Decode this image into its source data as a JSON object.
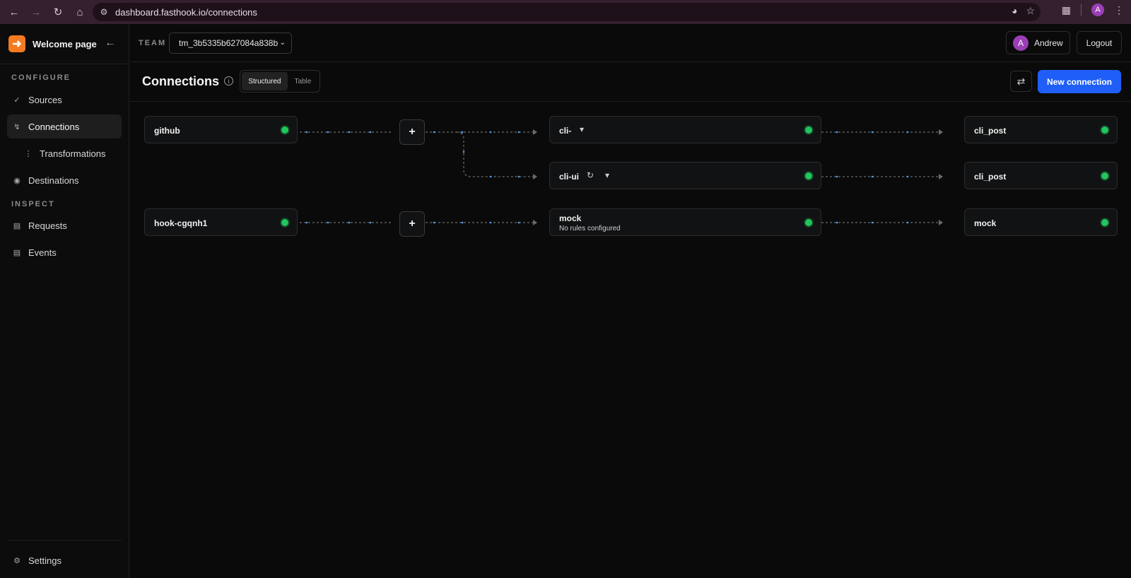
{
  "browser": {
    "url": "dashboard.fasthook.io/connections",
    "profile_initial": "A"
  },
  "sidebar": {
    "brand": "Welcome page",
    "sections": {
      "configure": "CONFIGURE",
      "inspect": "INSPECT"
    },
    "items": {
      "sources": "Sources",
      "connections": "Connections",
      "transformations": "Transformations",
      "destinations": "Destinations",
      "requests": "Requests",
      "events": "Events",
      "settings": "Settings"
    }
  },
  "topbar": {
    "team_label": "TEAM",
    "team_value": "tm_3b5335b627084a838b",
    "user_initial": "A",
    "user_name": "Andrew",
    "logout": "Logout"
  },
  "page": {
    "title": "Connections",
    "view_options": [
      "Structured",
      "Table"
    ],
    "active_view": "Structured",
    "new_connection": "New connection"
  },
  "graph": {
    "sources": [
      "github",
      "hook-cgqnh1"
    ],
    "connections": [
      {
        "name": "cli-",
        "subtitle": ""
      },
      {
        "name": "cli-ui",
        "subtitle": ""
      },
      {
        "name": "mock",
        "subtitle": "No rules configured"
      }
    ],
    "destinations": [
      "cli_post",
      "cli_post",
      "mock"
    ],
    "status_color": "#22c55e",
    "accent_color": "#1f5ff7"
  }
}
